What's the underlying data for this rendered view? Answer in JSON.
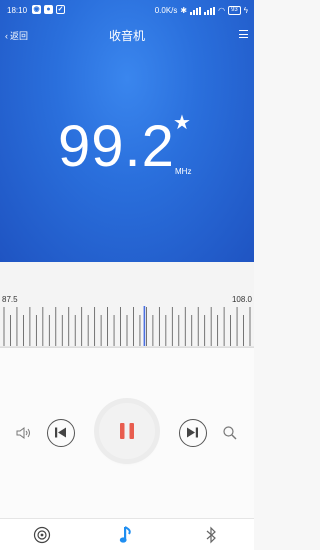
{
  "status": {
    "time": "18:10",
    "net_speed": "0.0K/s",
    "battery": "93"
  },
  "header": {
    "back_label": "返回",
    "title": "收音机"
  },
  "radio": {
    "frequency": "99.2",
    "unit": "MHz",
    "favorite": true
  },
  "tuner": {
    "min": "87.5",
    "max": "108.0",
    "current": 99.2,
    "range": [
      87.5,
      108.0
    ]
  },
  "controls": {
    "state": "playing"
  },
  "tabs": [
    "radio-icon",
    "music-icon",
    "bluetooth-icon"
  ],
  "colors": {
    "accent": "#2a6fdc",
    "play_icon": "#e85d4f",
    "indicator": "#4a6fe0",
    "active_tab": "#1f8ef1"
  }
}
